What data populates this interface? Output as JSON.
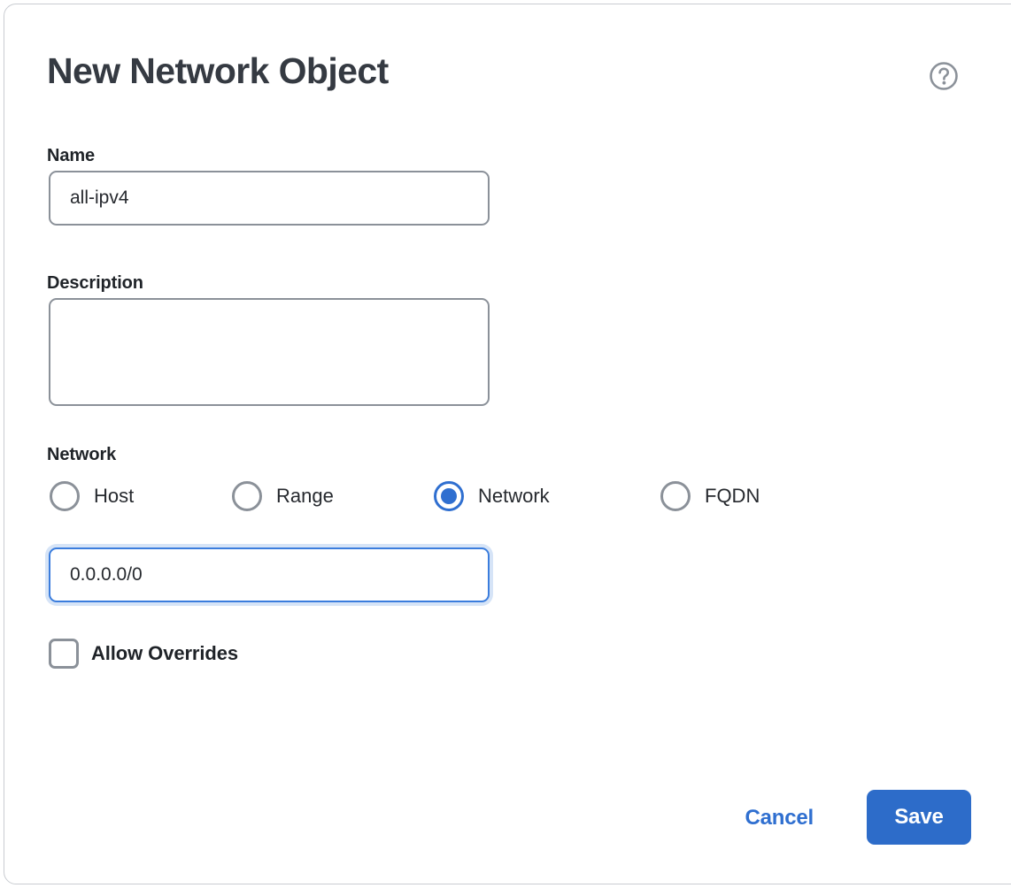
{
  "dialog": {
    "title": "New Network Object",
    "help_icon": "help-circle-icon"
  },
  "fields": {
    "name": {
      "label": "Name",
      "value": "all-ipv4",
      "placeholder": ""
    },
    "description": {
      "label": "Description",
      "value": "",
      "placeholder": ""
    },
    "network": {
      "label": "Network",
      "options": [
        {
          "label": "Host",
          "selected": false
        },
        {
          "label": "Range",
          "selected": false
        },
        {
          "label": "Network",
          "selected": true
        },
        {
          "label": "FQDN",
          "selected": false
        }
      ],
      "value": "0.0.0.0/0",
      "placeholder": ""
    },
    "allow_overrides": {
      "label": "Allow Overrides",
      "checked": false
    }
  },
  "footer": {
    "cancel_label": "Cancel",
    "save_label": "Save"
  },
  "colors": {
    "accent_blue": "#2d6cc9",
    "focus_border": "#3b7ddd",
    "focus_glow": "#d6e4f7",
    "radio_selected": "#2f6fd0",
    "control_border": "#8b9199",
    "title_text": "#353a42",
    "body_text": "#26292e"
  }
}
